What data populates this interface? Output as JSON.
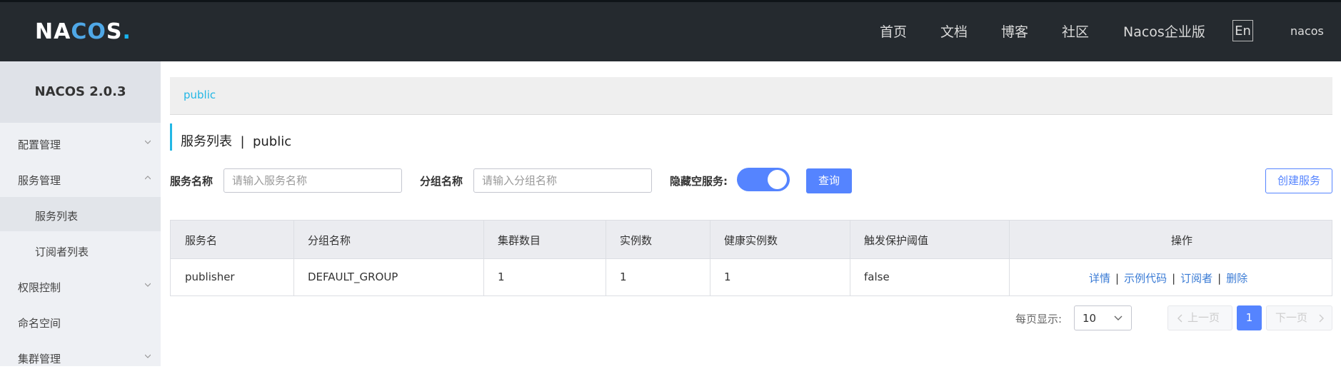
{
  "header": {
    "logo": {
      "n": "N",
      "a": "A",
      "co": "CO",
      "s": "S",
      "dot": "."
    },
    "nav": [
      "首页",
      "文档",
      "博客",
      "社区",
      "Nacos企业版"
    ],
    "lang": "En",
    "user": "nacos"
  },
  "sidebar": {
    "version": "NACOS 2.0.3",
    "items": [
      {
        "label": "配置管理"
      },
      {
        "label": "服务管理"
      },
      {
        "label": "服务列表"
      },
      {
        "label": "订阅者列表"
      },
      {
        "label": "权限控制"
      },
      {
        "label": "命名空间"
      },
      {
        "label": "集群管理"
      }
    ]
  },
  "breadcrumb": {
    "namespace": "public"
  },
  "page": {
    "title": "服务列表  |  public"
  },
  "filters": {
    "service_label": "服务名称",
    "service_placeholder": "请输入服务名称",
    "group_label": "分组名称",
    "group_placeholder": "请输入分组名称",
    "hide_empty_label": "隐藏空服务:",
    "search_button": "查询",
    "create_button": "创建服务"
  },
  "table": {
    "headers": [
      "服务名",
      "分组名称",
      "集群数目",
      "实例数",
      "健康实例数",
      "触发保护阈值",
      "操作"
    ],
    "rows": [
      {
        "name": "publisher",
        "group": "DEFAULT_GROUP",
        "clusters": "1",
        "instances": "1",
        "healthy": "1",
        "threshold": "false"
      }
    ],
    "ops": [
      "详情",
      "示例代码",
      "订阅者",
      "删除"
    ]
  },
  "pagination": {
    "per_page_label": "每页显示:",
    "per_page_value": "10",
    "prev": "上一页",
    "current": "1",
    "next": "下一页"
  }
}
